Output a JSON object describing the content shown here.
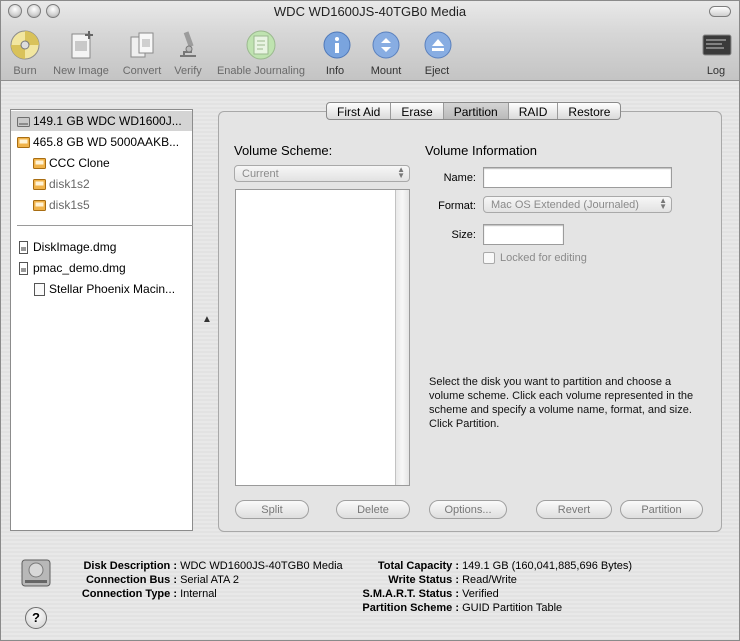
{
  "window": {
    "title": "WDC WD1600JS-40TGB0 Media"
  },
  "toolbar": {
    "items": [
      {
        "label": "Burn",
        "icon": "burn-icon"
      },
      {
        "label": "New Image",
        "icon": "new-image-icon"
      },
      {
        "label": "Convert",
        "icon": "convert-icon"
      },
      {
        "label": "Verify",
        "icon": "verify-microscope-icon"
      },
      {
        "label": "Enable Journaling",
        "icon": "journaling-icon"
      },
      {
        "label": "Info",
        "icon": "info-icon"
      },
      {
        "label": "Mount",
        "icon": "mount-icon"
      },
      {
        "label": "Eject",
        "icon": "eject-icon"
      },
      {
        "label": "Log",
        "icon": "log-icon"
      }
    ]
  },
  "sidebar": {
    "items": [
      {
        "label": "149.1 GB WDC WD1600J...",
        "icon": "internal-disk-icon"
      },
      {
        "label": "465.8 GB WD 5000AAKB...",
        "icon": "external-disk-icon"
      },
      {
        "label": "CCC Clone",
        "icon": "volume-icon"
      },
      {
        "label": "disk1s2",
        "icon": "volume-icon"
      },
      {
        "label": "disk1s5",
        "icon": "volume-icon"
      },
      {
        "label": "DiskImage.dmg",
        "icon": "dmg-file-icon"
      },
      {
        "label": "pmac_demo.dmg",
        "icon": "dmg-file-icon"
      },
      {
        "label": "Stellar Phoenix Macin...",
        "icon": "mounted-image-icon"
      }
    ]
  },
  "tabs": [
    {
      "label": "First Aid"
    },
    {
      "label": "Erase"
    },
    {
      "label": "Partition"
    },
    {
      "label": "RAID"
    },
    {
      "label": "Restore"
    }
  ],
  "partition": {
    "volume_scheme_title": "Volume Scheme:",
    "scheme_select_value": "Current",
    "volume_info_title": "Volume Information",
    "name_label": "Name:",
    "name_value": "",
    "format_label": "Format:",
    "format_value": "Mac OS Extended (Journaled)",
    "size_label": "Size:",
    "size_value": "",
    "locked_label": "Locked for editing",
    "help_text": "Select the disk you want to partition and choose a volume scheme. Click each volume represented in the scheme and specify a volume name, format, and size. Click Partition.",
    "buttons": {
      "split": "Split",
      "delete": "Delete",
      "options": "Options...",
      "revert": "Revert",
      "partition": "Partition"
    }
  },
  "footer": {
    "disk_description_label": "Disk Description :",
    "disk_description_value": "WDC WD1600JS-40TGB0 Media",
    "connection_bus_label": "Connection Bus :",
    "connection_bus_value": "Serial ATA 2",
    "connection_type_label": "Connection Type :",
    "connection_type_value": "Internal",
    "total_capacity_label": "Total Capacity :",
    "total_capacity_value": "149.1 GB (160,041,885,696 Bytes)",
    "write_status_label": "Write Status :",
    "write_status_value": "Read/Write",
    "smart_label": "S.M.A.R.T. Status :",
    "smart_value": "Verified",
    "partition_scheme_label": "Partition Scheme :",
    "partition_scheme_value": "GUID Partition Table",
    "help_glyph": "?"
  },
  "colors": {
    "accent_blue": "#6f9bd8",
    "disabled_text": "#8a8a8a",
    "selection_gray": "#d4d4d4"
  }
}
